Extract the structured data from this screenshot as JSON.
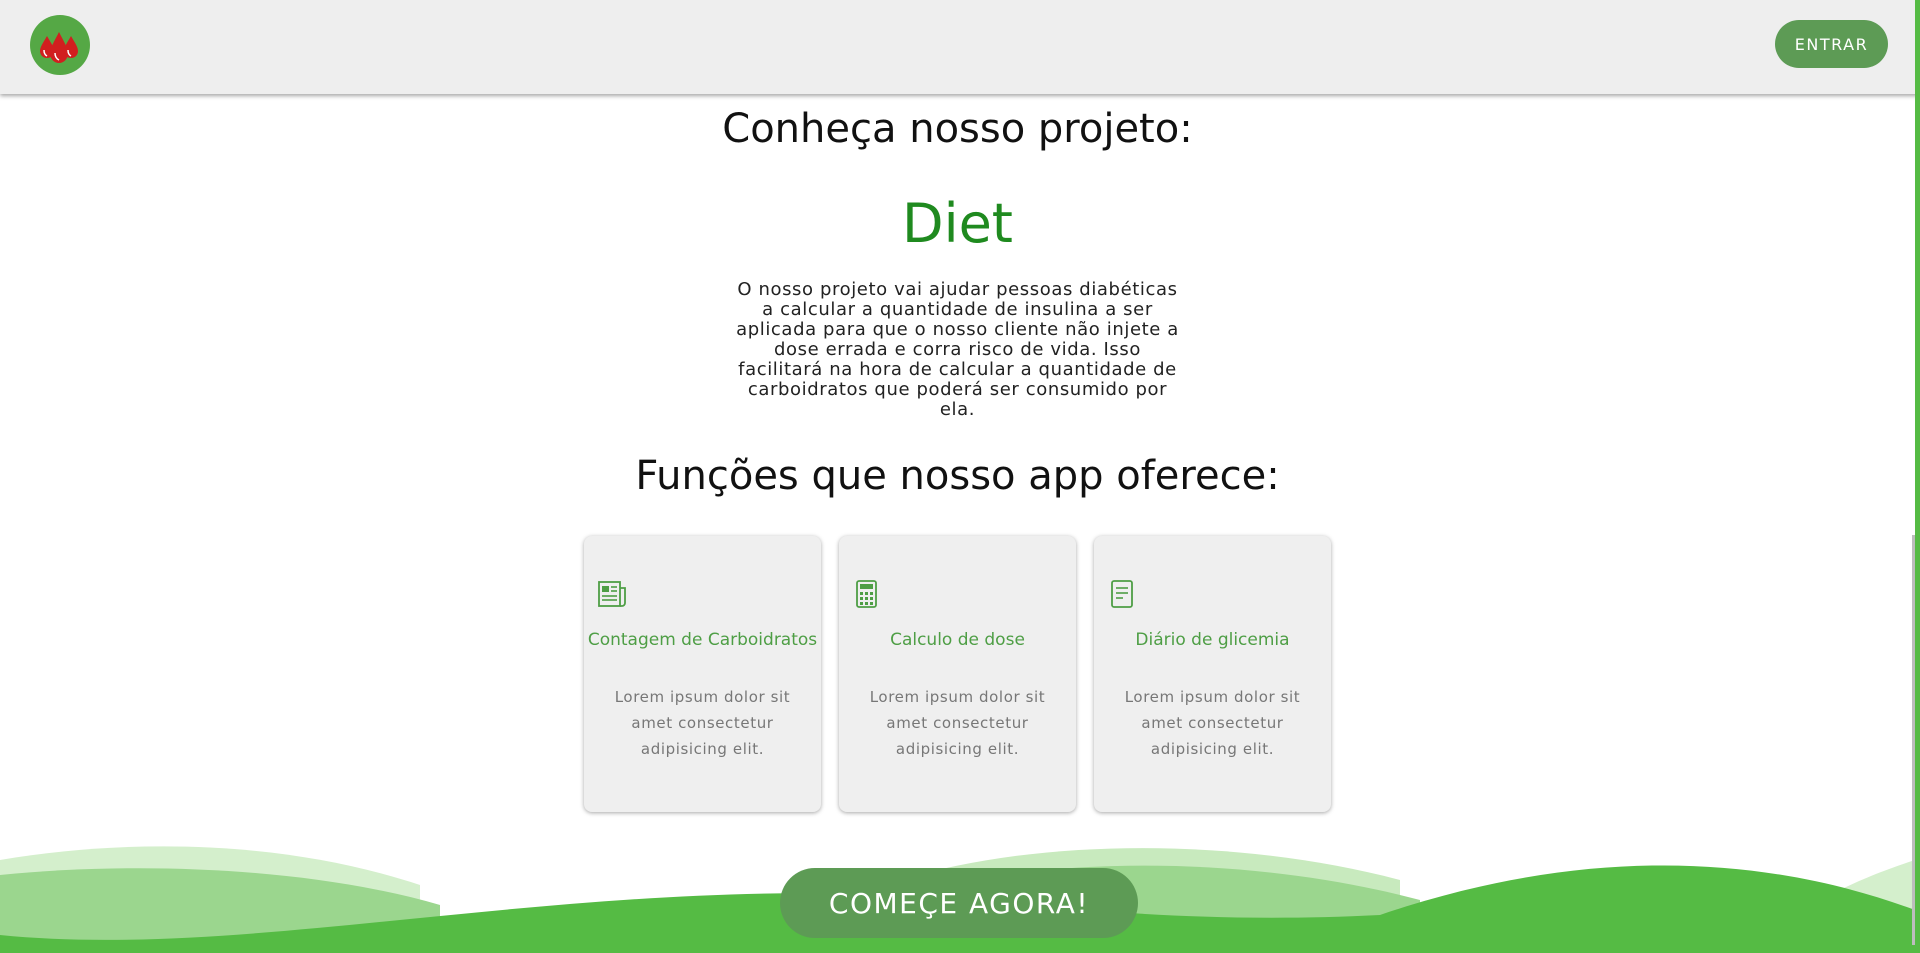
{
  "header": {
    "logo_icon": "blood-drops-icon",
    "login_label": "ENTRAR"
  },
  "about": {
    "heading": "Conheça nosso projeto:",
    "project_name": "Diet",
    "description": "O nosso projeto vai ajudar pessoas diabéticas a calcular a quantidade de insulina a ser aplicada para que o nosso cliente não injete a dose errada e corra risco de vida. Isso facilitará na hora de calcular a quantidade de carboidratos que poderá ser consumido por ela."
  },
  "features": {
    "heading": "Funções que nosso app oferece:",
    "cards": [
      {
        "icon": "newspaper-icon",
        "title": "Contagem de Carboidratos",
        "text": "Lorem ipsum dolor sit amet consectetur adipisicing elit."
      },
      {
        "icon": "calculator-icon",
        "title": "Calculo de dose",
        "text": "Lorem ipsum dolor sit amet consectetur adipisicing elit."
      },
      {
        "icon": "document-icon",
        "title": "Diário de glicemia",
        "text": "Lorem ipsum dolor sit amet consectetur adipisicing elit."
      }
    ]
  },
  "cta": {
    "label": "COMEÇE AGORA!"
  },
  "colors": {
    "brand_green": "#5d9b55",
    "title_green": "#1f8a1f",
    "wave_light": "#9bd68e",
    "wave_dark": "#55bb44",
    "drop_red": "#d11f1f"
  }
}
